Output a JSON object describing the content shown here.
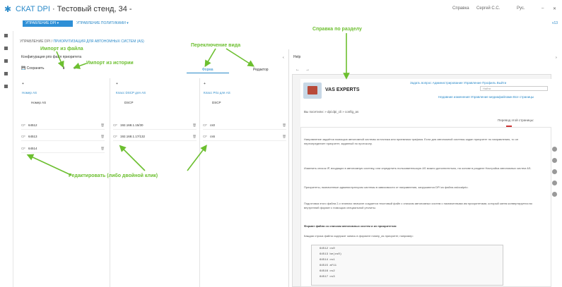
{
  "app": {
    "brand": "СКАТ DPI",
    "title": "Тестовый стенд, 34 -"
  },
  "topright": {
    "help": "Справка",
    "user": "Сергей С.С.",
    "lang": "Рус."
  },
  "nav": {
    "button": "УПРАВЛЕНИЕ DPI ▾",
    "link": "УПРАВЛЕНИЕ ПОЛИТИКАМИ ▾",
    "right": "v13"
  },
  "breadcrumb": {
    "root": "УПРАВЛЕНИЕ DPI",
    "sep": "/",
    "current": "ПРИОРИТИЗАЦИЯ ДЛЯ АВТОНОМНЫХ СИСТЕМ (AS)"
  },
  "page": {
    "heading": "Конфигурация prio файл приоритета"
  },
  "toolbar": {
    "save": "Сохранить"
  },
  "view_tabs": {
    "table": "Форма",
    "editor": "Редактор"
  },
  "columns": [
    {
      "header": "AS",
      "sub": "Номер AS",
      "value": "Номер AS"
    },
    {
      "header": "DSCP",
      "sub": "Класс DSCP для AS",
      "value": "DSCP"
    },
    {
      "header": "Prio",
      "sub": "Класс Prio для AS",
      "value": "DSCP"
    }
  ],
  "rows_c1": [
    {
      "k": "CF",
      "v": "64512"
    },
    {
      "k": "CF",
      "v": "64513"
    },
    {
      "k": "CF",
      "v": "64514"
    }
  ],
  "rows_c2": [
    {
      "k": "CF",
      "v": "192.168.1.15/30"
    },
    {
      "k": "CF",
      "v": "192.168.1.17/132"
    }
  ],
  "rows_c3": [
    {
      "k": "CF",
      "v": "cs0"
    },
    {
      "k": "CF",
      "v": "cs6"
    }
  ],
  "annotations": {
    "import_file": "Импорт из файла",
    "import_history": "Импорт из истории",
    "view_switch": "Переключение вида",
    "help_section": "Справка по разделу",
    "edit_hint": "Редактировать (либо двойной клик)"
  },
  "right": {
    "label": "Help",
    "brand": "VAS EXPERTS",
    "top_links": "Задать вопрос  Администрирование  Управление  Профиль  Выйти",
    "search_placeholder": "Найти",
    "sub_links": "Недавние изменения   Управление медиафайлами   Все страницы",
    "path": "Вы посетили: » dpi:dpi_cli » config_as",
    "translate": "Перевод этой страницы:",
    "p1": "Направление задаётся помощью автономной системы источника или приемника трафика. Если для автономной системы задан приоритет по направлению, то он переопределяет приоритет, заданный по протоколу.",
    "p2": "Изменить список IP, входящих в автономную систему, или определить пользовательскую AS можно дополнительно, на основе в разделе Настройка автономных систем AS.",
    "p3": "Приоритеты, назначенные администратором системы в зависимости от направления, загружаются DPI из файла aslocalprio.",
    "p4": "Подготовка этого файла 2-х этапная: вначале создается текстовый файл с списком автономных систем с назначенными им приоритетами, который затем конвертируется во внутренний формат с помощью специальной утилиты.",
    "subhead": "Формат файла со списком автономных систем и их приоритетов:",
    "p5": "Каждая строка файла содержит запись в формате номер_as приоритет, например:",
    "code": [
      "64512  cs0",
      "64513  be(cs0)",
      "64514  cs1",
      "64515  af11",
      "64516  cs2",
      "64517  cs3"
    ]
  },
  "colors": {
    "accent": "#2b8ac9",
    "annotation": "#6cbf2f"
  }
}
